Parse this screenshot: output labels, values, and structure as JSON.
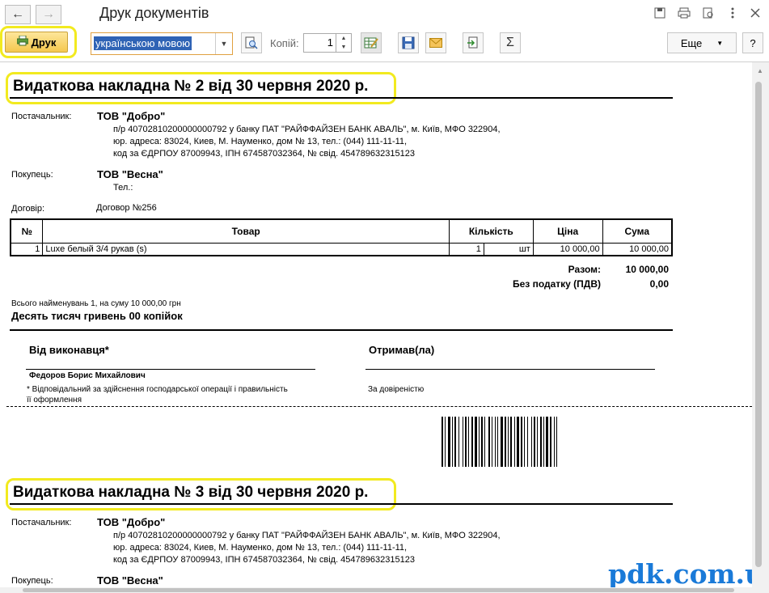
{
  "window": {
    "title": "Друк документів",
    "back_icon": "←",
    "forward_icon": "→"
  },
  "toolbar": {
    "print_label": "Друк",
    "language": "українською мовою",
    "copies_label": "Копій:",
    "copies_value": "1",
    "more_label": "Еще",
    "help_label": "?"
  },
  "documents": [
    {
      "title": "Видаткова накладна № 2 від 30 червня 2020 р.",
      "supplier_label": "Постачальник:",
      "supplier_name": "ТОВ \"Добро\"",
      "supplier_line1": "п/р 40702810200000000792 у банку ПАТ \"РАЙФФАЙЗЕН БАНК АВАЛЬ\", м. Київ, МФО 322904,",
      "supplier_line2": "юр. адреса: 83024, Киев, М. Науменко, дом № 13, тел.: (044) 111-11-11,",
      "supplier_line3": "код за ЄДРПОУ 87009943, ІПН 674587032364, № свід.  454789632315123",
      "buyer_label": "Покупець:",
      "buyer_name": "ТОВ \"Весна\"",
      "buyer_phone": "Тел.:",
      "contract_label": "Договір:",
      "contract_value": "Договор №256",
      "table": {
        "headers": [
          "№",
          "Товар",
          "Кількість",
          "Ціна",
          "Сума"
        ],
        "rows": [
          {
            "num": "1",
            "item": "Luxe белый 3/4 рукав (s)",
            "qty": "1",
            "unit": "шт",
            "price": "10 000,00",
            "sum": "10 000,00"
          }
        ]
      },
      "total_label": "Разом:",
      "total_value": "10 000,00",
      "vat_label": "Без податку (ПДВ)",
      "vat_value": "0,00",
      "summary_line": "Всього найменувань 1, на суму 10 000,00 грн",
      "amount_words": "Десять тисяч гривень 00 копійок",
      "from_label": "Від виконавця*",
      "received_label": "Отримав(ла)",
      "executor_name": "Федоров Борис Михайлович",
      "footnote_line1": "* Відповідальний за здійснення господарської операції і правильність",
      "footnote_line2": "її оформлення",
      "proxy_label": "За довіреністю"
    },
    {
      "title": "Видаткова накладна № 3 від 30 червня 2020 р.",
      "supplier_label": "Постачальник:",
      "supplier_name": "ТОВ \"Добро\"",
      "supplier_line1": "п/р 40702810200000000792 у банку ПАТ \"РАЙФФАЙЗЕН БАНК АВАЛЬ\", м. Київ, МФО 322904,",
      "supplier_line2": "юр. адреса: 83024, Киев, М. Науменко, дом № 13, тел.: (044) 111-11-11,",
      "supplier_line3": "код за ЄДРПОУ 87009943, ІПН 674587032364, № свід.  454789632315123",
      "buyer_label": "Покупець:",
      "buyer_name": "ТОВ \"Весна\""
    }
  ],
  "watermark": "pdk.com.ua",
  "colors": {
    "highlight": "#f2ea1f",
    "print_button": "#f5c84e",
    "selection": "#2f63b5",
    "watermark": "#1a7ad8"
  }
}
